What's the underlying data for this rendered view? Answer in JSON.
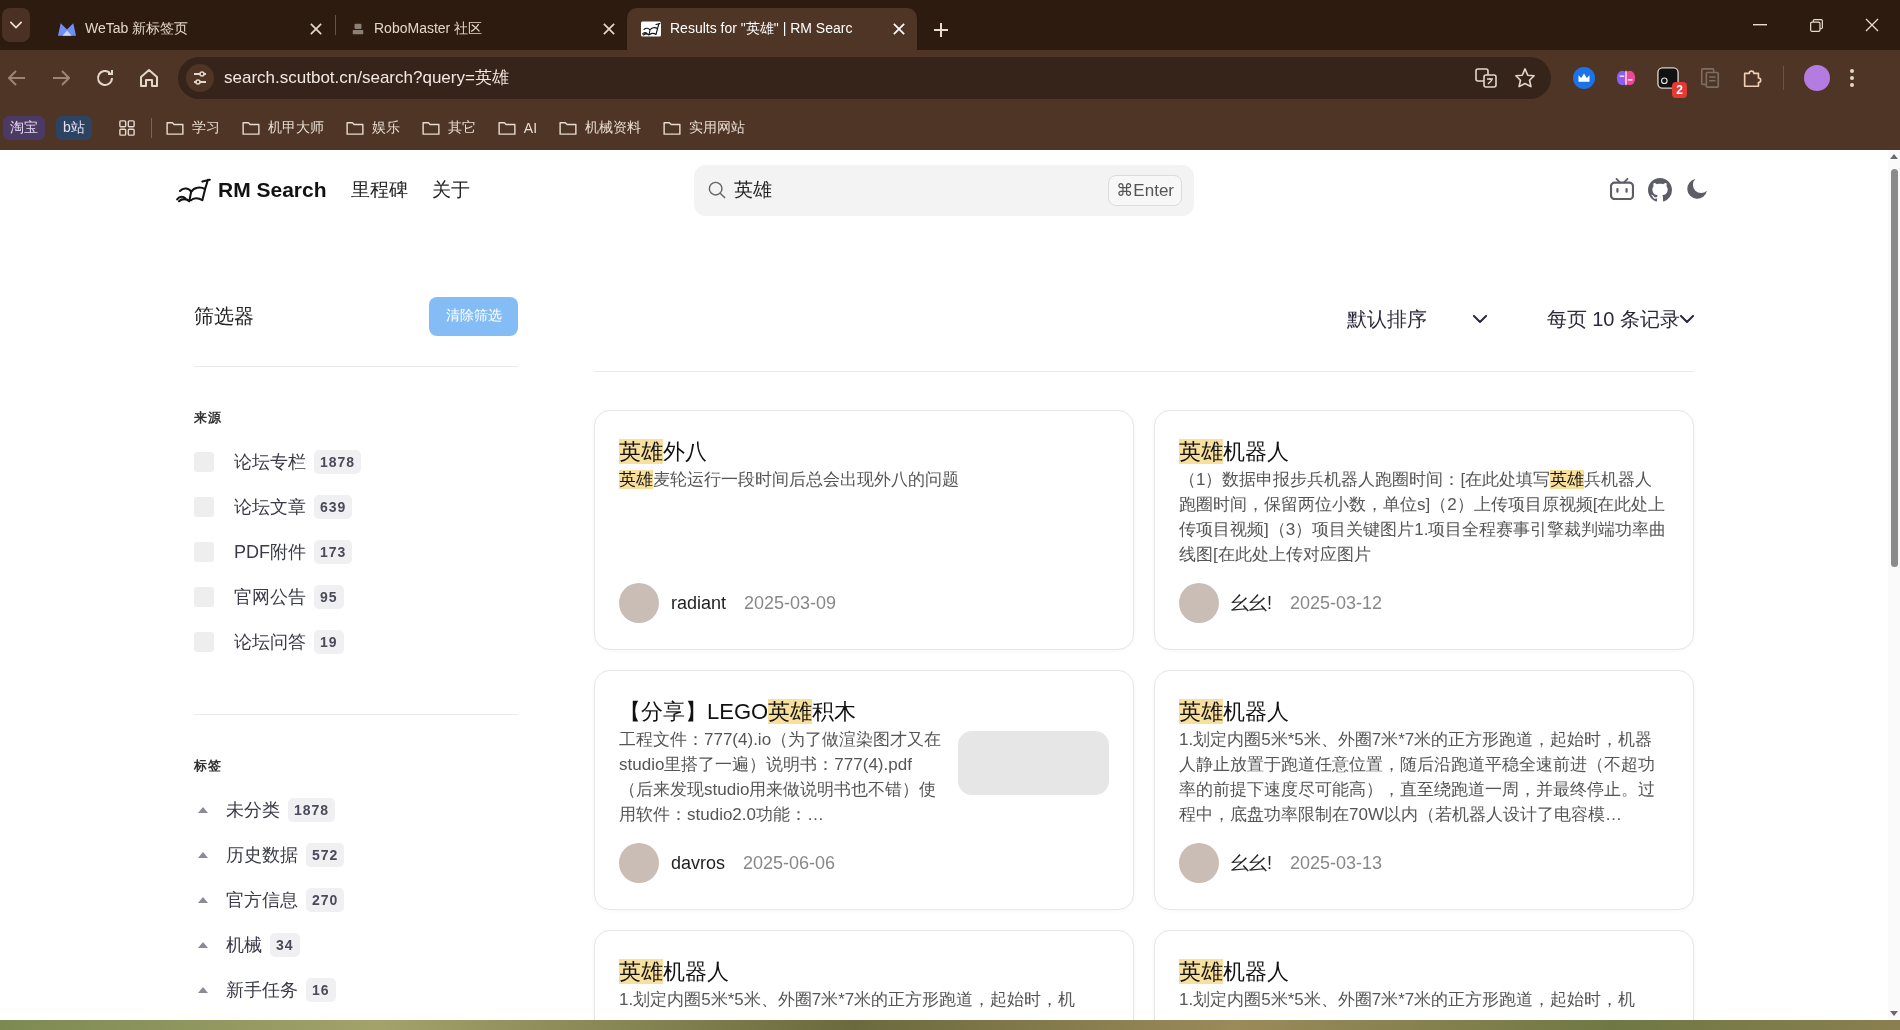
{
  "browser": {
    "tabs": [
      {
        "title": "WeTab 新标签页",
        "selected": false
      },
      {
        "title": "RoboMaster 社区",
        "selected": false
      },
      {
        "title": "Results for \"英雄\" | RM Searc",
        "selected": true
      }
    ],
    "address": "search.scutbot.cn/search?query=英雄",
    "extension_badge": "2",
    "bookmarks": [
      {
        "kind": "chip",
        "label": "淘宝",
        "color": "#4b3a63"
      },
      {
        "kind": "chip",
        "label": "b站",
        "color": "#2c4461"
      },
      {
        "kind": "folder",
        "label": "学习"
      },
      {
        "kind": "folder",
        "label": "机甲大师"
      },
      {
        "kind": "folder",
        "label": "娱乐"
      },
      {
        "kind": "folder",
        "label": "其它"
      },
      {
        "kind": "folder",
        "label": "AI"
      },
      {
        "kind": "folder",
        "label": "机械资料"
      },
      {
        "kind": "folder",
        "label": "实用网站"
      }
    ]
  },
  "header": {
    "brand": "RM Search",
    "nav": [
      "里程碑",
      "关于"
    ],
    "search": {
      "value": "英雄",
      "shortcut": "⌘Enter"
    }
  },
  "filters": {
    "title": "筛选器",
    "clear_button": "清除筛选",
    "sections": [
      {
        "kind": "checkbox",
        "title": "来源",
        "items": [
          {
            "label": "论坛专栏",
            "count": "1878",
            "checked": false
          },
          {
            "label": "论坛文章",
            "count": "639",
            "checked": false
          },
          {
            "label": "PDF附件",
            "count": "173",
            "checked": false
          },
          {
            "label": "官网公告",
            "count": "95",
            "checked": false
          },
          {
            "label": "论坛问答",
            "count": "19",
            "checked": false
          }
        ]
      },
      {
        "kind": "tree",
        "title": "标签",
        "items": [
          {
            "label": "未分类",
            "count": "1878"
          },
          {
            "label": "历史数据",
            "count": "572"
          },
          {
            "label": "官方信息",
            "count": "270"
          },
          {
            "label": "机械",
            "count": "34"
          },
          {
            "label": "新手任务",
            "count": "16"
          }
        ]
      }
    ]
  },
  "sort": {
    "order": "默认排序",
    "page_size": "每页 10 条记录"
  },
  "results": [
    {
      "title": "**英雄**外八",
      "snippet": "**英雄**麦轮运行一段时间后总会出现外八的问题",
      "thumbnail": false,
      "author": "radiant",
      "date": "2025-03-09"
    },
    {
      "title": "**英雄**机器人",
      "snippet": "（1）数据申报步兵机器人跑圈时间：[在此处填写**英雄**兵机器人跑圈时间，保留两位小数，单位s]（2）上传项目原视频[在此处上传项目视频]（3）项目关键图片1.项目全程赛事引擎裁判端功率曲线图[在此处上传对应图片",
      "thumbnail": false,
      "author": "幺幺!",
      "date": "2025-03-12"
    },
    {
      "title": "【分享】LEGO**英雄**积木",
      "snippet": "工程文件：777(4).io（为了做渲染图才又在studio里搭了一遍）说明书：777(4).pdf（后来发现studio用来做说明书也不错）使用软件：studio2.0功能：…",
      "thumbnail": true,
      "author": "davros",
      "date": "2025-06-06"
    },
    {
      "title": "**英雄**机器人",
      "snippet": "1.划定内圈5米*5米、外圈7米*7米的正方形跑道，起始时，机器人静止放置于跑道任意位置，随后沿跑道平稳全速前进（不超功率的前提下速度尽可能高），直至绕跑道一周，并最终停止。过程中，底盘功率限制在70W以内（若机器人设计了电容模…",
      "thumbnail": false,
      "author": "幺幺!",
      "date": "2025-03-13"
    },
    {
      "title": "**英雄**机器人",
      "snippet": "1.划定内圈5米*5米、外圈7米*7米的正方形跑道，起始时，机",
      "thumbnail": false
    },
    {
      "title": "**英雄**机器人",
      "snippet": "1.划定内圈5米*5米、外圈7米*7米的正方形跑道，起始时，机",
      "thumbnail": false
    }
  ]
}
